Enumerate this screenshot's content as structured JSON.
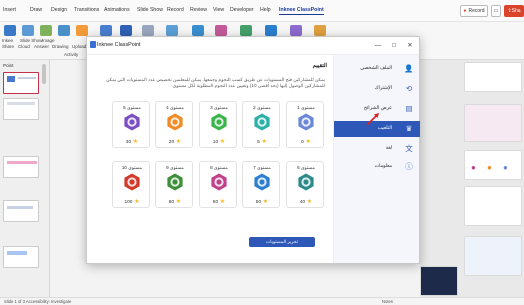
{
  "menubar": {
    "items": [
      "Insert",
      "Draw",
      "Design",
      "Transitions",
      "Animations",
      "Slide Show",
      "Record",
      "Review",
      "View",
      "Developer",
      "Help",
      "Inknee ClassPoint"
    ],
    "record_label": "Record",
    "share_label": "Sha"
  },
  "ribbon": {
    "labels": [
      "Inkee",
      "Slide Show",
      "Image",
      "Share",
      "Cloud",
      "Answer",
      "Drawing",
      "Upload"
    ],
    "group_label": "Activity"
  },
  "left_panel": {
    "title": "Point"
  },
  "dialog": {
    "title": "Inknee ClassPoint",
    "window_controls": [
      "—",
      "□",
      "✕"
    ],
    "main_title": "التقييم",
    "description": "يمكن للمشاركين فتح المستويات عن طريق كسب النجوم وجمعها. يمكن للمعلمين تخصيص عدد المستويات التي يمكن للمشاركين الوصول إليها (بحد أقصى 10) وتعيين عدد النجوم المطلوبة لكل مستوى.",
    "claim_button": "تحرير المستويات",
    "sidebar": [
      {
        "label": "الملف الشخصي",
        "icon": "user-icon"
      },
      {
        "label": "الإشتراك",
        "icon": "refresh-icon"
      },
      {
        "label": "عرض الشرائح",
        "icon": "slides-icon"
      },
      {
        "label": "التلعيب",
        "icon": "gamification-icon",
        "active": true
      },
      {
        "label": "لغة",
        "icon": "language-icon"
      },
      {
        "label": "معلومات",
        "icon": "info-icon"
      }
    ],
    "levels": [
      {
        "label": "مستوى 1",
        "stars": "0",
        "color": "#6b88d8"
      },
      {
        "label": "مستوى 2",
        "stars": "5",
        "color": "#2bb1a7"
      },
      {
        "label": "مستوى 3",
        "stars": "10",
        "color": "#39b54a"
      },
      {
        "label": "مستوى 4",
        "stars": "20",
        "color": "#f08a24"
      },
      {
        "label": "مستوى 5",
        "stars": "30",
        "color": "#7b4fc4"
      },
      {
        "label": "مستوى 6",
        "stars": "40",
        "color": "#2d8a8a"
      },
      {
        "label": "مستوى 7",
        "stars": "50",
        "color": "#2c7fd0"
      },
      {
        "label": "مستوى 8",
        "stars": "60",
        "color": "#c0408a"
      },
      {
        "label": "مستوى 9",
        "stars": "80",
        "color": "#3d8f3a"
      },
      {
        "label": "مستوى 10",
        "stars": "100",
        "color": "#d23a2a"
      }
    ]
  },
  "status_bar": {
    "left": "Slide 1 of 3   Accessibility: Investigate",
    "right": "Notes"
  },
  "colors": {
    "accent": "#2d58b8",
    "star": "#f1b81f",
    "record_red": "#d9442b"
  }
}
